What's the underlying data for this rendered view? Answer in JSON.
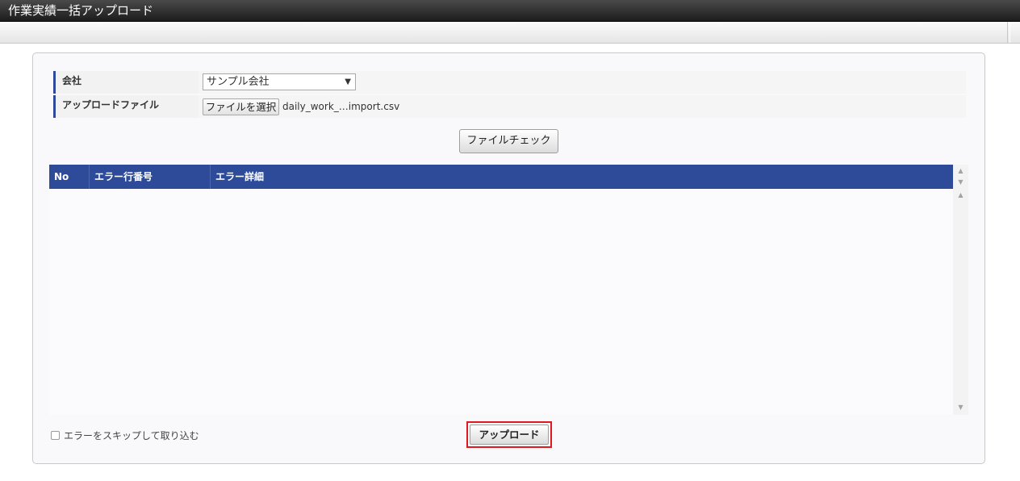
{
  "window": {
    "title": "作業実績一括アップロード"
  },
  "form": {
    "company_label": "会社",
    "company_value": "サンプル会社",
    "company_dropdown_arrow": "▼",
    "file_label": "アップロードファイル",
    "file_button": "ファイルを選択",
    "file_name": "daily_work_…import.csv"
  },
  "file_check_button": "ファイルチェック",
  "error_table": {
    "columns": [
      "No",
      "エラー行番号",
      "エラー詳細"
    ],
    "rows": []
  },
  "skip_errors": {
    "label": "エラーをスキップして取り込む",
    "checked": false
  },
  "upload_button": "アップロード",
  "colors": {
    "header_bg": "#2e4b9a",
    "highlight_border": "#e0191f"
  }
}
